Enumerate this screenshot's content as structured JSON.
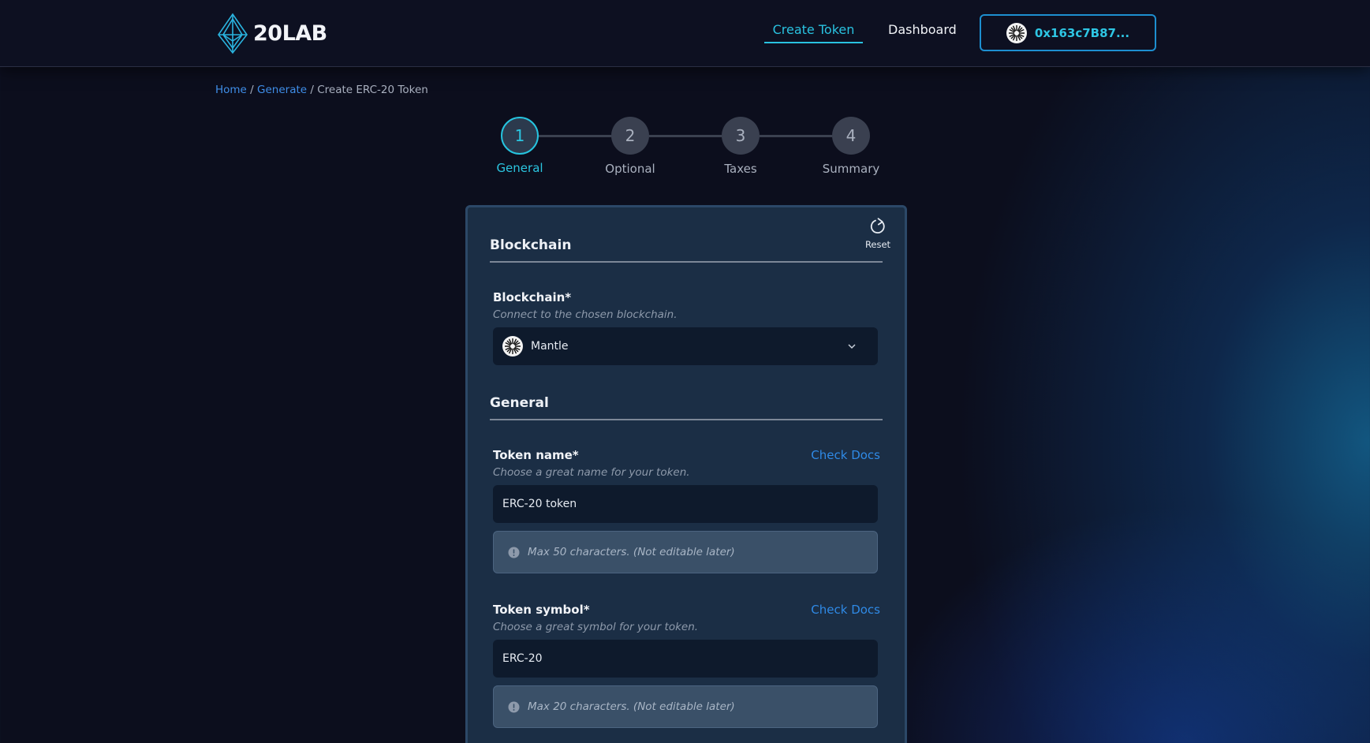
{
  "header": {
    "logo_text": "20LAB",
    "nav": {
      "create_token": "Create Token",
      "dashboard": "Dashboard"
    },
    "wallet": {
      "address": "0x163c7B87...",
      "icon": "mantle-chain-icon"
    }
  },
  "breadcrumb": {
    "home": "Home",
    "sep": "/",
    "generate": "Generate",
    "current": "Create ERC-20 Token"
  },
  "stepper": {
    "active_step": 1,
    "steps": [
      {
        "number": "1",
        "label": "General"
      },
      {
        "number": "2",
        "label": "Optional"
      },
      {
        "number": "3",
        "label": "Taxes"
      },
      {
        "number": "4",
        "label": "Summary"
      }
    ]
  },
  "form": {
    "reset_label": "Reset",
    "blockchain_section": {
      "title": "Blockchain",
      "field_label": "Blockchain*",
      "help": "Connect to the chosen blockchain.",
      "selected": "Mantle"
    },
    "general_section": {
      "title": "General",
      "token_name": {
        "label": "Token name*",
        "docs": "Check Docs",
        "help": "Choose a great name for your token.",
        "value": "ERC-20 token",
        "note": "Max 50 characters. (Not editable later)"
      },
      "token_symbol": {
        "label": "Token symbol*",
        "docs": "Check Docs",
        "help": "Choose a great symbol for your token.",
        "value": "ERC-20",
        "note": "Max 20 characters. (Not editable later)"
      }
    }
  },
  "colors": {
    "accent": "#29c2e0",
    "link": "#2f8ae6",
    "background": "#0c0e1d",
    "card": "#1b2e45"
  }
}
